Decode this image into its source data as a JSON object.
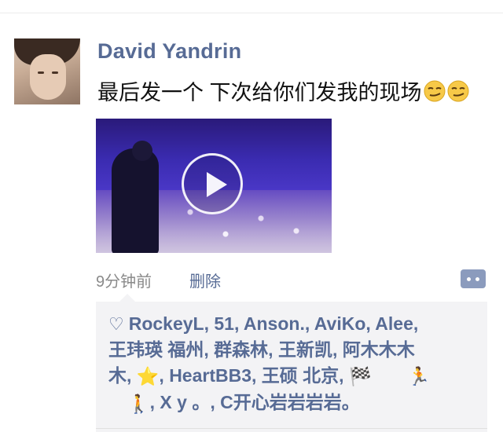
{
  "post": {
    "username": "David Yandrin",
    "text": "最后发一个 下次给你们发我的现场",
    "emoji": [
      "smirk-face-icon",
      "smirk-face-icon"
    ],
    "timestamp": "9分钟前",
    "delete_label": "删除"
  },
  "likes": {
    "icon": "heart-outline-icon",
    "line1": "RockeyL, 51, Anson., AviKo, Alee,",
    "line2": "王玮瑛 福州, 群森林, 王新凯, 阿木木木",
    "line3_a": "木, ",
    "line3_emoji": "⭐",
    "line3_b": ", HeartBB3, 王硕 北京, ",
    "line3_flag": "🏁",
    "line3_runner": "🏃",
    "line4_person": "🚶",
    "line4_b": ", X y 。, C开心岩岩岩岩。"
  },
  "colors": {
    "name_blue": "#576b95",
    "likes_bg": "#f3f3f5",
    "comment_btn": "#8b9bbd"
  }
}
